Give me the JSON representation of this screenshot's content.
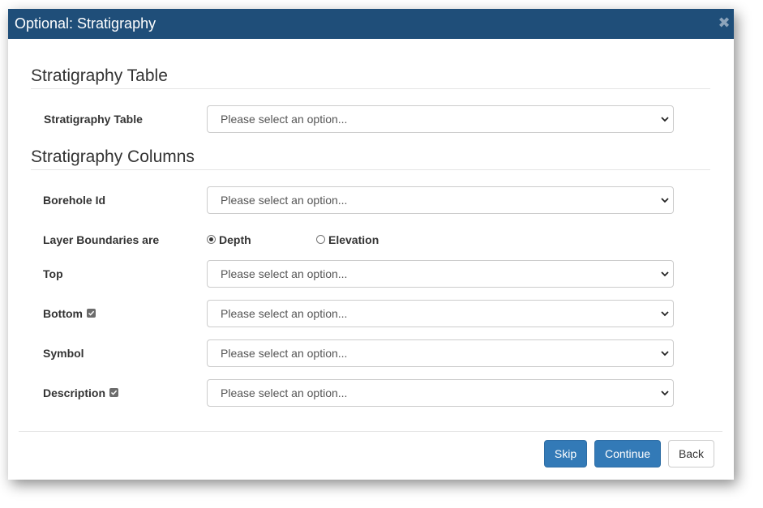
{
  "dialog": {
    "title": "Optional: Stratigraphy",
    "close_icon": "close-icon"
  },
  "sections": {
    "table_title": "Stratigraphy Table",
    "columns_title": "Stratigraphy Columns"
  },
  "fields": {
    "stratigraphy_table": {
      "label": "Stratigraphy Table",
      "value": "Please select an option..."
    },
    "borehole_id": {
      "label": "Borehole Id",
      "value": "Please select an option..."
    },
    "layer_boundaries": {
      "label": "Layer Boundaries are",
      "options": [
        "Depth",
        "Elevation"
      ],
      "selected": "Depth"
    },
    "top": {
      "label": "Top",
      "value": "Please select an option..."
    },
    "bottom": {
      "label": "Bottom",
      "value": "Please select an option...",
      "checked": true
    },
    "symbol": {
      "label": "Symbol",
      "value": "Please select an option..."
    },
    "description": {
      "label": "Description",
      "value": "Please select an option...",
      "checked": true
    }
  },
  "buttons": {
    "skip": "Skip",
    "continue": "Continue",
    "back": "Back"
  },
  "colors": {
    "titlebar": "#1f4e79",
    "primary": "#337ab7"
  }
}
